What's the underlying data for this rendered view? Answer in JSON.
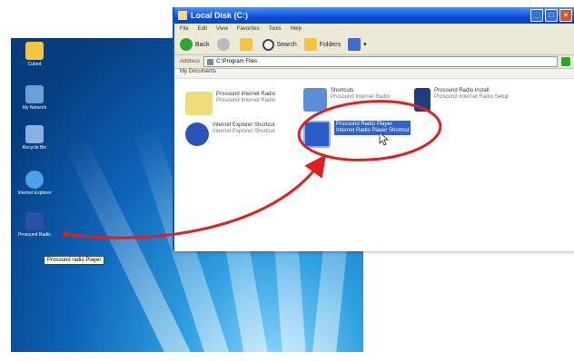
{
  "desktop": {
    "icons": [
      {
        "label": "Cubed",
        "icon": "folder-icon",
        "color": "#f3c440"
      },
      {
        "label": "My Network",
        "icon": "network-icon",
        "color": "#6aa0d8"
      },
      {
        "label": "Recycle Bin",
        "icon": "recycle-bin-icon",
        "color": "#88b0e0"
      },
      {
        "label": "Internet Explorer",
        "icon": "browser-icon",
        "color": "#4aa3e8"
      },
      {
        "label": "Prosound Radio",
        "icon": "app-icon",
        "color": "#2c4fa8"
      }
    ],
    "tooltip": "Prosound radio Player"
  },
  "window": {
    "title": "Local Disk (C:)",
    "menu": [
      "File",
      "Edit",
      "View",
      "Favorites",
      "Tools",
      "Help"
    ],
    "toolbar": {
      "back": "Back",
      "search": "Search",
      "folders": "Folders"
    },
    "address_label": "Address",
    "address_value": "C:\\Program Files",
    "folder_title": "My Documents",
    "items": [
      {
        "name": "Prosound Internet Radio",
        "desc": "Prosound Internet Radio",
        "icon": "folder-icon",
        "color": "#f0dc7a"
      },
      {
        "name": "Shortcuts",
        "desc": "Prosound Internet Radio",
        "icon": "shortcut-icon",
        "color": "#5a8fd8"
      },
      {
        "name": "Prosound Radio Install",
        "desc": "Prosound Internet Radio Setup",
        "icon": "installer-icon",
        "color": "#1d3f7a"
      },
      {
        "name": "Internet Explorer Shortcut",
        "desc": "Internet Explorer Shortcut",
        "icon": "info-icon",
        "color": "#2a55b8"
      },
      {
        "name": "Prosound Radio Player",
        "desc": "Internet Radio Player Shortcut",
        "icon": "player-icon",
        "color": "#2b5bc4"
      }
    ]
  },
  "colors": {
    "arrow": "#e02020",
    "selection": "#3162c4"
  }
}
